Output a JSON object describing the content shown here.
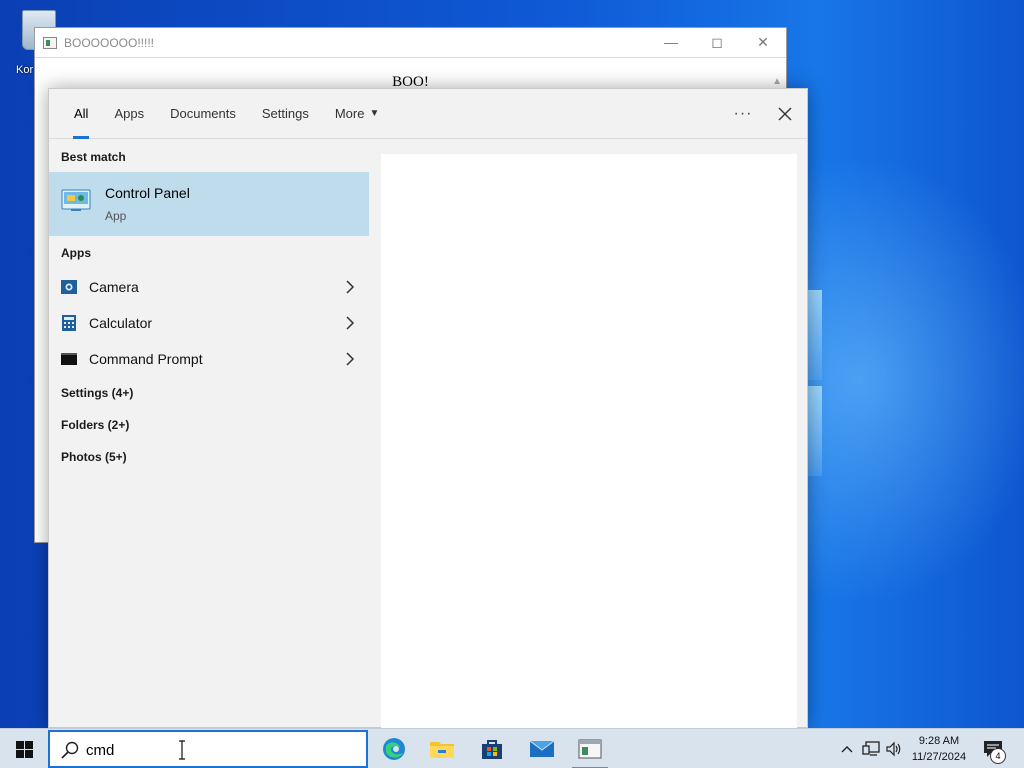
{
  "desktop": {
    "icon_label": "Kor",
    "icon_name": "recycle-bin-icon"
  },
  "background_window": {
    "title": "BOOOOOOO!!!!!",
    "content_text": "BOO!"
  },
  "search_panel": {
    "tabs": [
      {
        "label": "All",
        "active": true
      },
      {
        "label": "Apps"
      },
      {
        "label": "Documents"
      },
      {
        "label": "Settings"
      },
      {
        "label": "More"
      }
    ],
    "best_match_header": "Best match",
    "best_match": {
      "title": "Control Panel",
      "subtitle": "App",
      "icon": "control-panel-icon"
    },
    "apps_header": "Apps",
    "apps": [
      {
        "label": "Camera",
        "icon": "camera-icon"
      },
      {
        "label": "Calculator",
        "icon": "calculator-icon"
      },
      {
        "label": "Command Prompt",
        "icon": "command-prompt-icon"
      }
    ],
    "categories": [
      {
        "label": "Settings (4+)"
      },
      {
        "label": "Folders (2+)"
      },
      {
        "label": "Photos (5+)"
      }
    ]
  },
  "taskbar": {
    "search_value": "cmd",
    "pinned": [
      {
        "name": "edge",
        "icon": "edge-icon"
      },
      {
        "name": "file-explorer",
        "icon": "folder-icon"
      },
      {
        "name": "store",
        "icon": "store-icon"
      },
      {
        "name": "mail",
        "icon": "mail-icon"
      },
      {
        "name": "running-app",
        "icon": "window-app-icon"
      }
    ],
    "time": "9:28 AM",
    "date": "11/27/2024",
    "notification_count": "4"
  },
  "colors": {
    "accent": "#1a73d4",
    "best_match_highlight": "#bfdcec",
    "taskbar_bg": "#d9e3ee",
    "desktop_blue": "#0f5ad6"
  }
}
